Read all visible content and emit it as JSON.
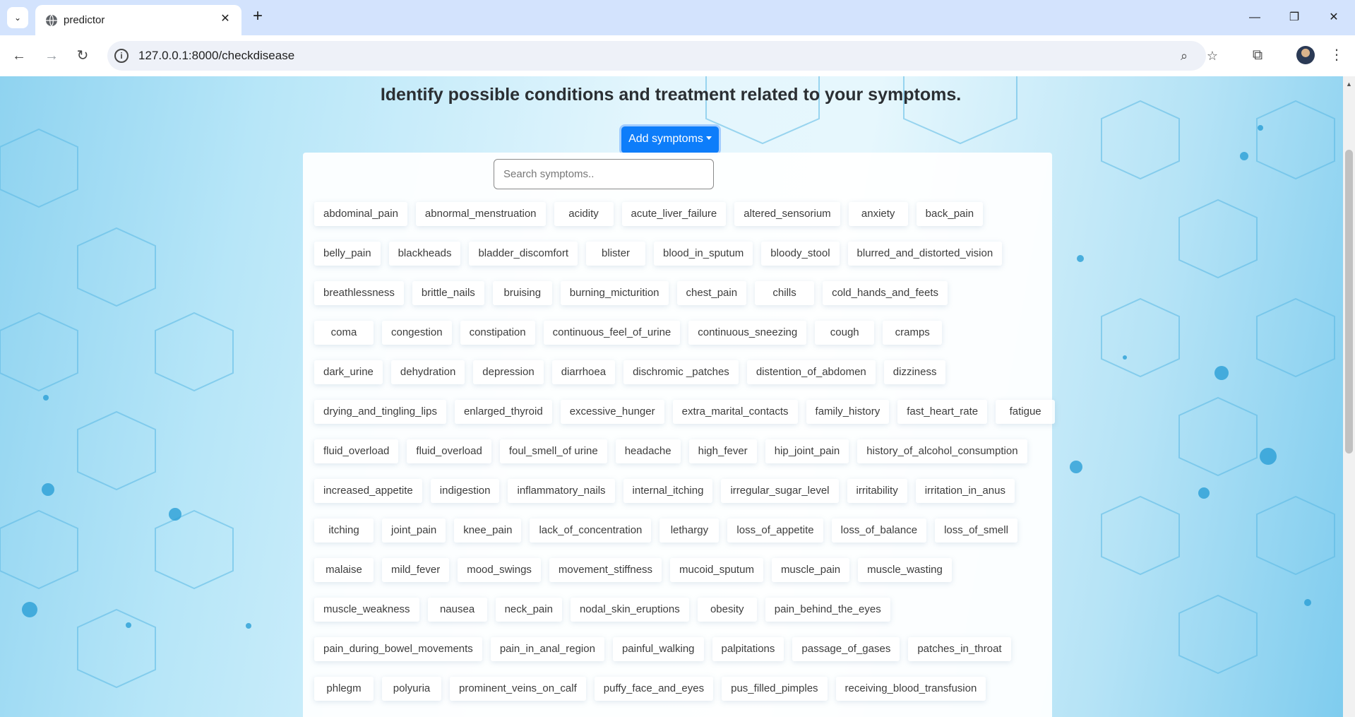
{
  "browser": {
    "tab_title": "predictor",
    "url": "127.0.0.1:8000/checkdisease"
  },
  "page": {
    "heading": "Identify possible conditions and treatment related to your symptoms.",
    "add_button_label": "Add symptoms",
    "search_placeholder": "Search symptoms..",
    "symptom_rows": [
      [
        "abdominal_pain",
        "abnormal_menstruation",
        "acidity",
        "acute_liver_failure",
        "altered_sensorium",
        "anxiety",
        "back_pain"
      ],
      [
        "belly_pain",
        "blackheads",
        "bladder_discomfort",
        "blister",
        "blood_in_sputum",
        "bloody_stool",
        "blurred_and_distorted_vision"
      ],
      [
        "breathlessness",
        "brittle_nails",
        "bruising",
        "burning_micturition",
        "chest_pain",
        "chills",
        "cold_hands_and_feets"
      ],
      [
        "coma",
        "congestion",
        "constipation",
        "continuous_feel_of_urine",
        "continuous_sneezing",
        "cough",
        "cramps"
      ],
      [
        "dark_urine",
        "dehydration",
        "depression",
        "diarrhoea",
        "dischromic _patches",
        "distention_of_abdomen",
        "dizziness"
      ],
      [
        "drying_and_tingling_lips",
        "enlarged_thyroid",
        "excessive_hunger",
        "extra_marital_contacts",
        "family_history",
        "fast_heart_rate",
        "fatigue"
      ],
      [
        "fluid_overload",
        "fluid_overload",
        "foul_smell_of urine",
        "headache",
        "high_fever",
        "hip_joint_pain",
        "history_of_alcohol_consumption"
      ],
      [
        "increased_appetite",
        "indigestion",
        "inflammatory_nails",
        "internal_itching",
        "irregular_sugar_level",
        "irritability",
        "irritation_in_anus"
      ],
      [
        "itching",
        "joint_pain",
        "knee_pain",
        "lack_of_concentration",
        "lethargy",
        "loss_of_appetite",
        "loss_of_balance",
        "loss_of_smell"
      ],
      [
        "malaise",
        "mild_fever",
        "mood_swings",
        "movement_stiffness",
        "mucoid_sputum",
        "muscle_pain",
        "muscle_wasting"
      ],
      [
        "muscle_weakness",
        "nausea",
        "neck_pain",
        "nodal_skin_eruptions",
        "obesity",
        "pain_behind_the_eyes"
      ],
      [
        "pain_during_bowel_movements",
        "pain_in_anal_region",
        "painful_walking",
        "palpitations",
        "passage_of_gases",
        "patches_in_throat"
      ],
      [
        "phlegm",
        "polyuria",
        "prominent_veins_on_calf",
        "puffy_face_and_eyes",
        "pus_filled_pimples",
        "receiving_blood_transfusion"
      ]
    ]
  },
  "colors": {
    "accent": "#0d7dfa",
    "tabbar": "#d3e3fd"
  }
}
